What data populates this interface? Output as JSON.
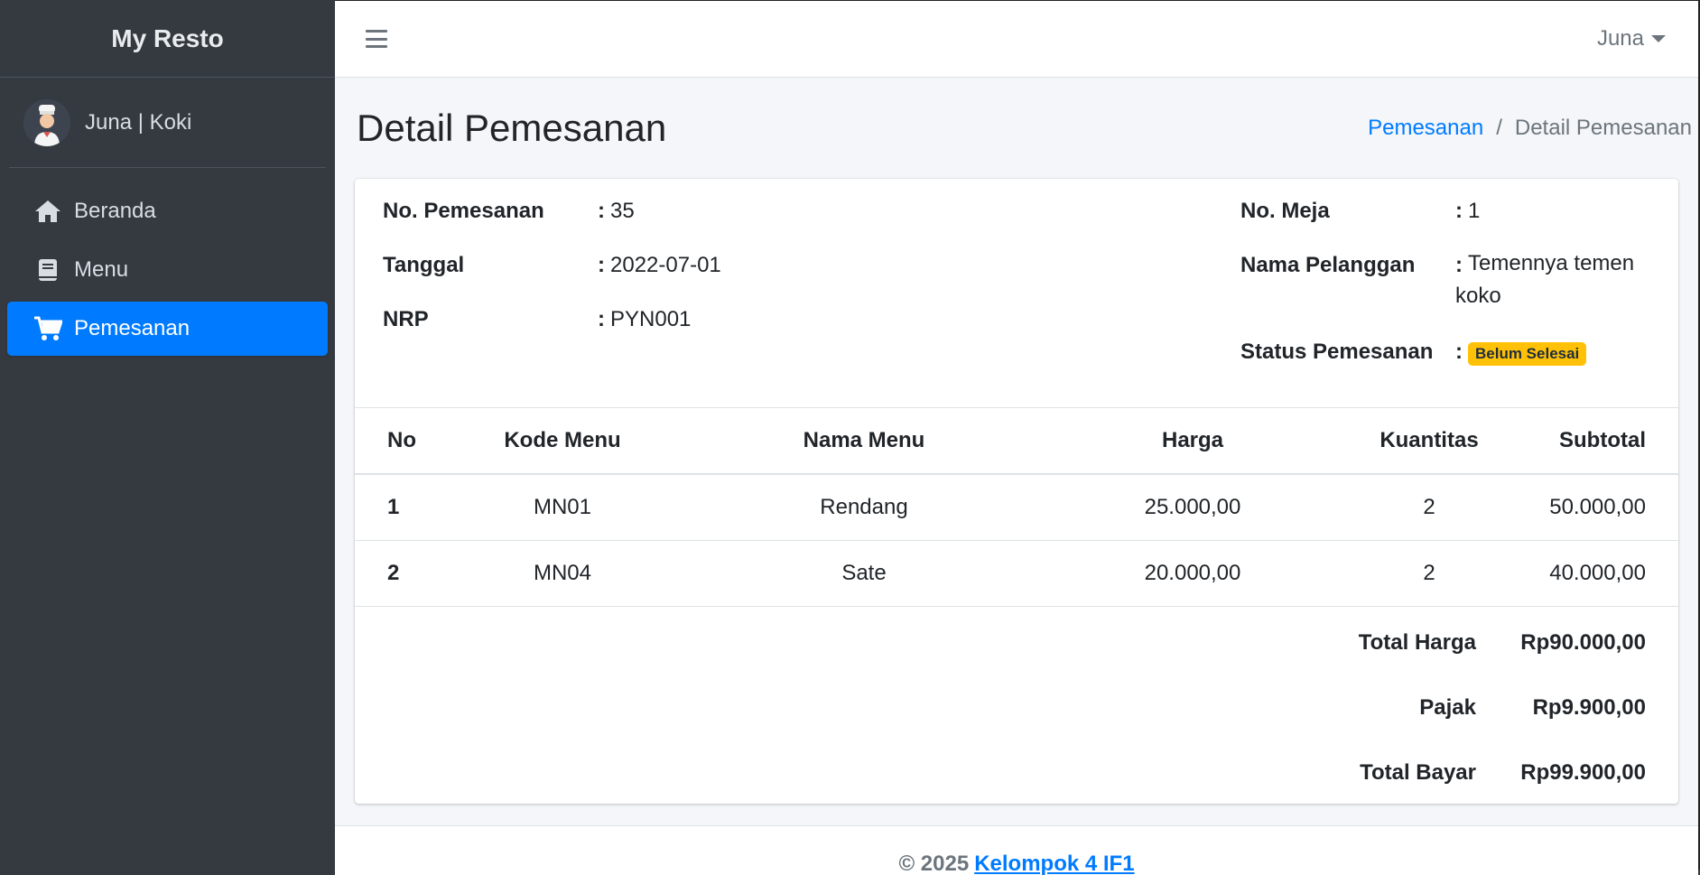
{
  "app": {
    "brand": "My Resto"
  },
  "sidebar": {
    "user": "Juna | Koki",
    "items": [
      {
        "label": "Beranda",
        "icon": "home-icon",
        "active": false
      },
      {
        "label": "Menu",
        "icon": "book-icon",
        "active": false
      },
      {
        "label": "Pemesanan",
        "icon": "cart-icon",
        "active": true
      }
    ]
  },
  "topbar": {
    "user": "Juna"
  },
  "header": {
    "title": "Detail Pemesanan",
    "breadcrumb": {
      "parent": "Pemesanan",
      "current": "Detail Pemesanan"
    }
  },
  "order": {
    "no_label": "No. Pemesanan",
    "no": "35",
    "date_label": "Tanggal",
    "date": "2022-07-01",
    "nrp_label": "NRP",
    "nrp": "PYN001",
    "table_label": "No. Meja",
    "table": "1",
    "customer_label": "Nama Pelanggan",
    "customer_line1": "Temennya temen",
    "customer_line2": "koko",
    "status_label": "Status Pemesanan",
    "status": "Belum Selesai",
    "colon": ":"
  },
  "items_table": {
    "headers": [
      "No",
      "Kode Menu",
      "Nama Menu",
      "Harga",
      "Kuantitas",
      "Subtotal"
    ],
    "rows": [
      [
        "1",
        "MN01",
        "Rendang",
        "25.000,00",
        "2",
        "50.000,00"
      ],
      [
        "2",
        "MN04",
        "Sate",
        "20.000,00",
        "2",
        "40.000,00"
      ]
    ]
  },
  "totals": {
    "total_harga_label": "Total Harga",
    "total_harga": "Rp90.000,00",
    "pajak_label": "Pajak",
    "pajak": "Rp9.900,00",
    "total_bayar_label": "Total Bayar",
    "total_bayar": "Rp99.900,00"
  },
  "footer": {
    "copyright": "© 2025",
    "team": "Kelompok 4 IF1"
  },
  "colors": {
    "primary": "#007bff",
    "sidebar": "#343a40",
    "warning": "#ffc107"
  }
}
